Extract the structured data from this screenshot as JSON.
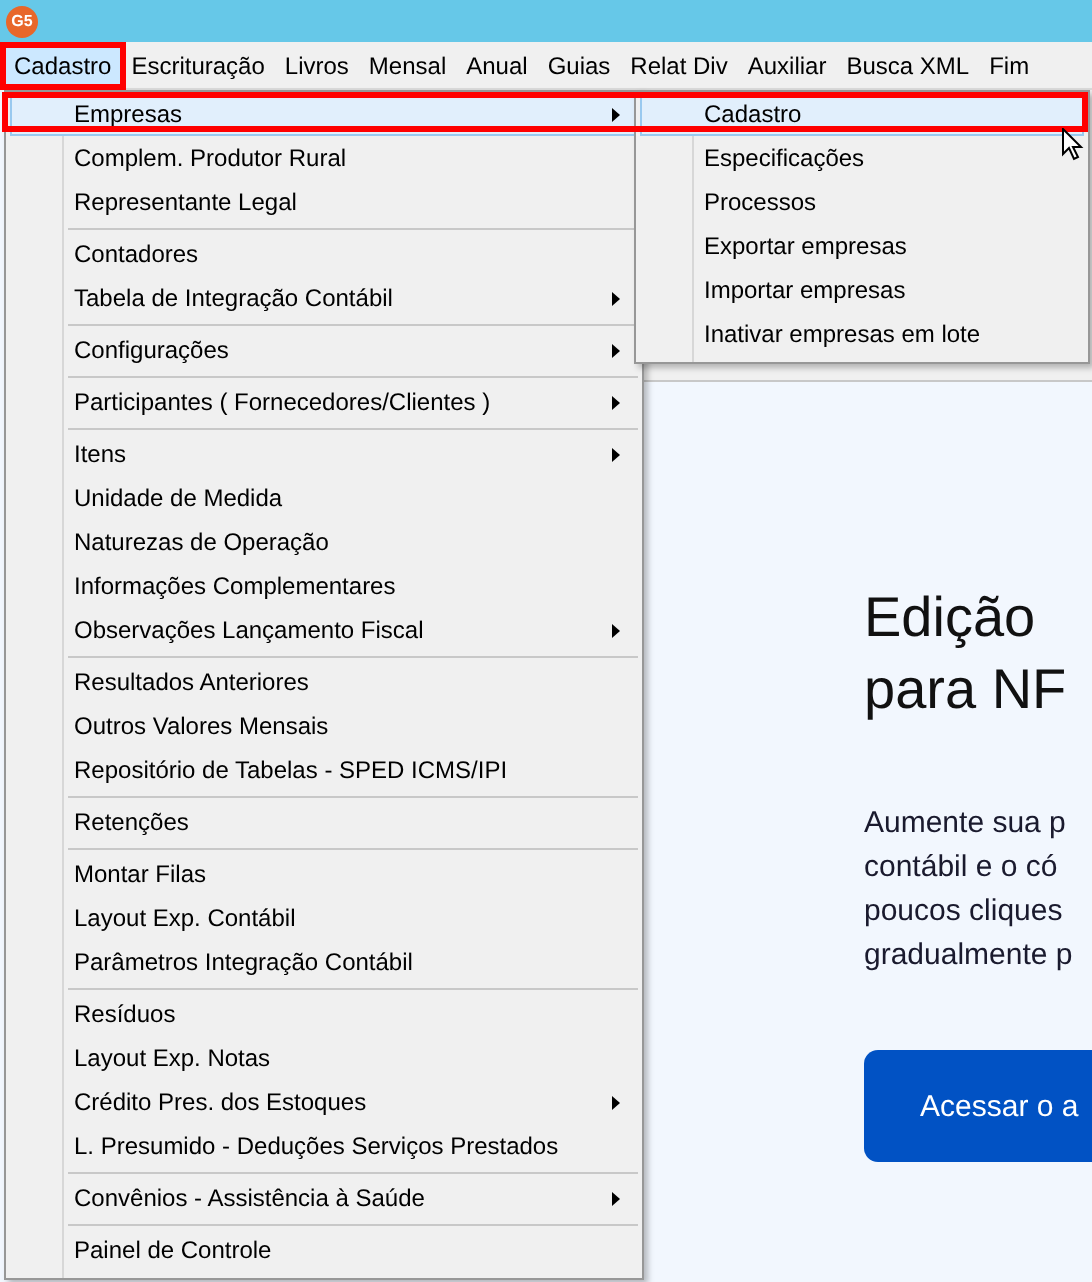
{
  "app": {
    "logo": "G5"
  },
  "menu_bar": [
    {
      "label": "Cadastro",
      "selected": true
    },
    {
      "label": "Escrituração",
      "selected": false
    },
    {
      "label": "Livros",
      "selected": false
    },
    {
      "label": "Mensal",
      "selected": false
    },
    {
      "label": "Anual",
      "selected": false
    },
    {
      "label": "Guias",
      "selected": false
    },
    {
      "label": "Relat Div",
      "selected": false
    },
    {
      "label": "Auxiliar",
      "selected": false
    },
    {
      "label": "Busca XML",
      "selected": false
    },
    {
      "label": "Fim",
      "selected": false
    }
  ],
  "main_menu": [
    {
      "kind": "item",
      "label": "Empresas",
      "submenu": true,
      "selected": true
    },
    {
      "kind": "item",
      "label": "Complem. Produtor Rural",
      "submenu": false,
      "selected": false
    },
    {
      "kind": "item",
      "label": "Representante Legal",
      "submenu": false,
      "selected": false
    },
    {
      "kind": "separator"
    },
    {
      "kind": "item",
      "label": "Contadores",
      "submenu": false,
      "selected": false
    },
    {
      "kind": "item",
      "label": "Tabela de Integração Contábil",
      "submenu": true,
      "selected": false
    },
    {
      "kind": "separator"
    },
    {
      "kind": "item",
      "label": "Configurações",
      "submenu": true,
      "selected": false
    },
    {
      "kind": "separator"
    },
    {
      "kind": "item",
      "label": "Participantes ( Fornecedores/Clientes )",
      "submenu": true,
      "selected": false
    },
    {
      "kind": "separator"
    },
    {
      "kind": "item",
      "label": "Itens",
      "submenu": true,
      "selected": false
    },
    {
      "kind": "item",
      "label": "Unidade de Medida",
      "submenu": false,
      "selected": false
    },
    {
      "kind": "item",
      "label": "Naturezas de Operação",
      "submenu": false,
      "selected": false
    },
    {
      "kind": "item",
      "label": "Informações Complementares",
      "submenu": false,
      "selected": false
    },
    {
      "kind": "item",
      "label": "Observações Lançamento Fiscal",
      "submenu": true,
      "selected": false
    },
    {
      "kind": "separator"
    },
    {
      "kind": "item",
      "label": "Resultados Anteriores",
      "submenu": false,
      "selected": false
    },
    {
      "kind": "item",
      "label": "Outros Valores Mensais",
      "submenu": false,
      "selected": false
    },
    {
      "kind": "item",
      "label": "Repositório de Tabelas - SPED ICMS/IPI",
      "submenu": false,
      "selected": false
    },
    {
      "kind": "separator"
    },
    {
      "kind": "item",
      "label": "Retenções",
      "submenu": false,
      "selected": false
    },
    {
      "kind": "separator"
    },
    {
      "kind": "item",
      "label": "Montar Filas",
      "submenu": false,
      "selected": false
    },
    {
      "kind": "item",
      "label": "Layout Exp. Contábil",
      "submenu": false,
      "selected": false
    },
    {
      "kind": "item",
      "label": "Parâmetros Integração Contábil",
      "submenu": false,
      "selected": false
    },
    {
      "kind": "separator"
    },
    {
      "kind": "item",
      "label": "Resíduos",
      "submenu": false,
      "selected": false
    },
    {
      "kind": "item",
      "label": "Layout Exp. Notas",
      "submenu": false,
      "selected": false
    },
    {
      "kind": "item",
      "label": "Crédito Pres. dos Estoques",
      "submenu": true,
      "selected": false
    },
    {
      "kind": "item",
      "label": "L. Presumido - Deduções Serviços Prestados",
      "submenu": false,
      "selected": false
    },
    {
      "kind": "separator"
    },
    {
      "kind": "item",
      "label": "Convênios - Assistência à Saúde",
      "submenu": true,
      "selected": false
    },
    {
      "kind": "separator"
    },
    {
      "kind": "item",
      "label": "Painel de Controle",
      "submenu": false,
      "selected": false
    }
  ],
  "submenu": [
    {
      "label": "Cadastro",
      "selected": true
    },
    {
      "label": "Especificações",
      "selected": false
    },
    {
      "label": "Processos",
      "selected": false
    },
    {
      "label": "Exportar empresas",
      "selected": false
    },
    {
      "label": "Importar empresas",
      "selected": false
    },
    {
      "label": "Inativar empresas em lote",
      "selected": false
    }
  ],
  "page": {
    "heading": [
      "Edição",
      "para NF"
    ],
    "paragraph": [
      "Aumente sua p",
      "contábil e o có",
      "poucos cliques",
      "gradualmente p"
    ],
    "button": "Acessar o a"
  }
}
